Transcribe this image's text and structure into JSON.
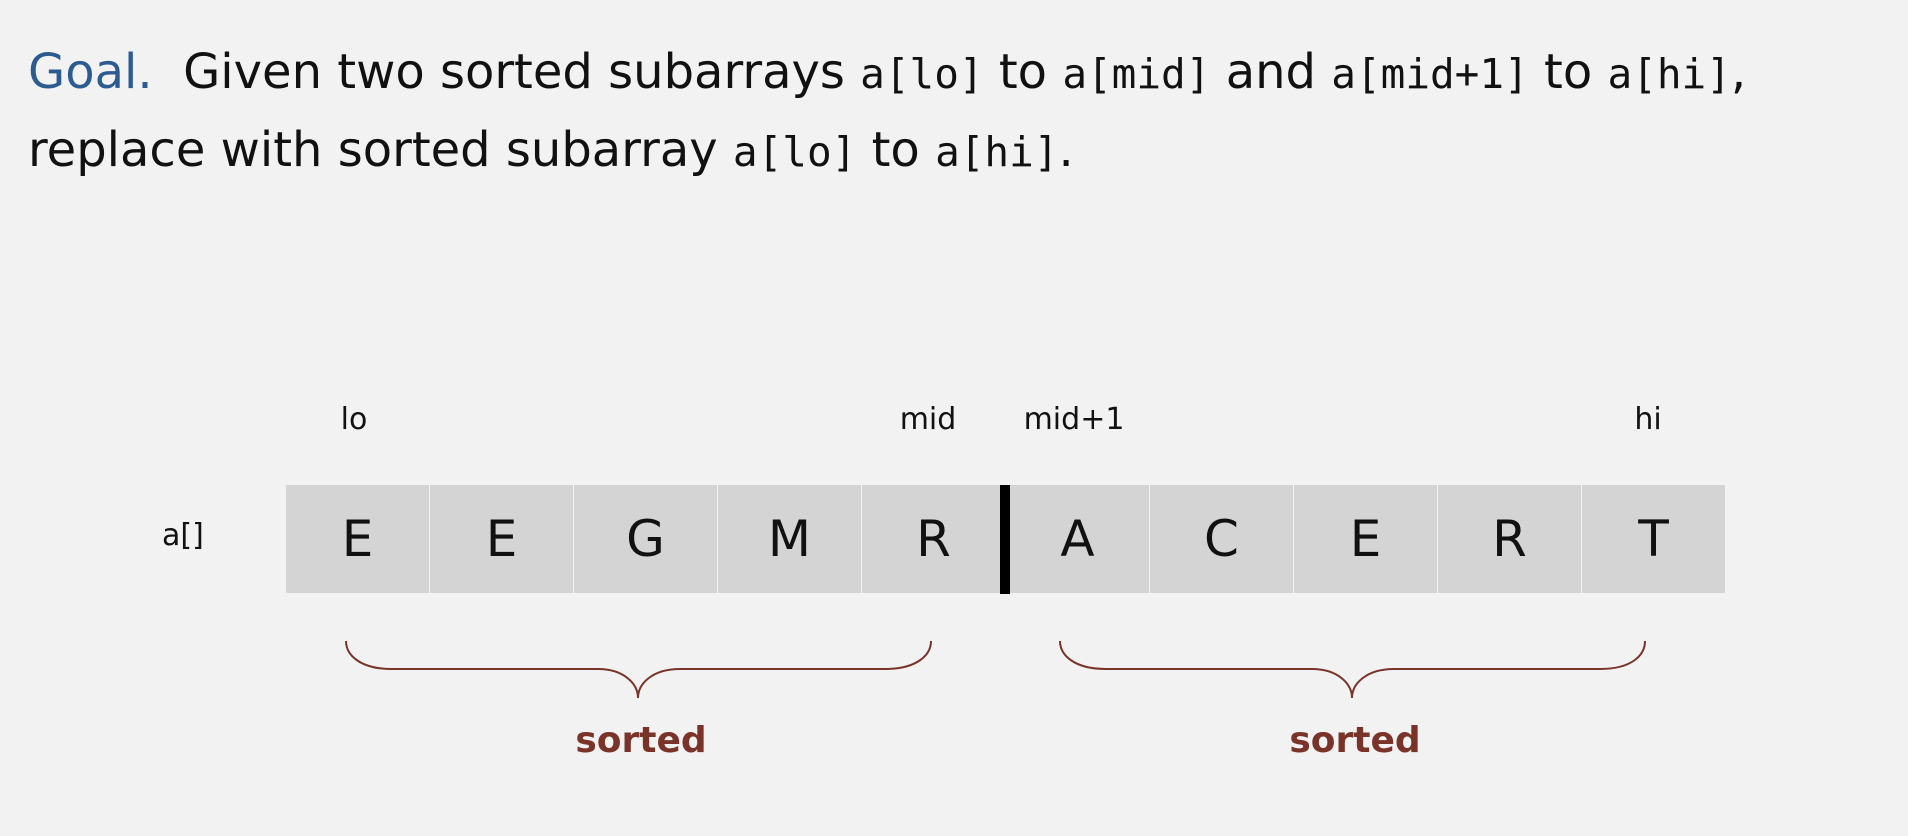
{
  "goal": {
    "label": "Goal.",
    "line1_text1": "Given two sorted subarrays",
    "code_lo": "a[lo]",
    "to": "to",
    "code_mid": "a[mid]",
    "and": "and",
    "code_mid1": "a[mid+1]",
    "code_hi": "a[hi]",
    "comma": ",",
    "line2_text1": "replace with sorted subarray",
    "period": "."
  },
  "diagram": {
    "array_name": "a[]",
    "labels": {
      "lo": "lo",
      "mid": "mid",
      "mid_plus_one": "mid+1",
      "hi": "hi"
    },
    "cells": [
      "E",
      "E",
      "G",
      "M",
      "R",
      "A",
      "C",
      "E",
      "R",
      "T"
    ],
    "sorted_left": "sorted",
    "sorted_right": "sorted",
    "colors": {
      "cell": "#d4d4d4",
      "brace": "#7a3328",
      "goal": "#2b5b91"
    }
  }
}
